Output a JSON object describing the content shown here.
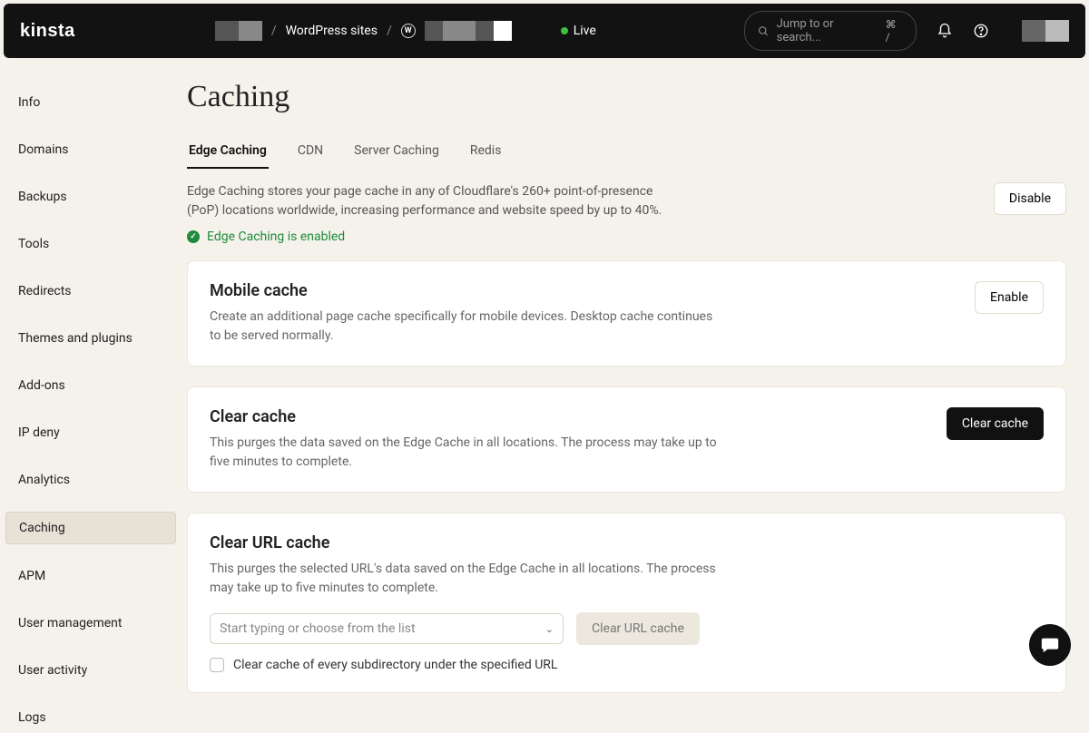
{
  "header": {
    "logo": "kinsta",
    "breadcrumb_sites": "WordPress sites",
    "env_label": "Live",
    "search_placeholder": "Jump to or search...",
    "search_kbd": "⌘ /"
  },
  "sidebar": {
    "items": [
      {
        "label": "Info"
      },
      {
        "label": "Domains"
      },
      {
        "label": "Backups"
      },
      {
        "label": "Tools"
      },
      {
        "label": "Redirects"
      },
      {
        "label": "Themes and plugins"
      },
      {
        "label": "Add-ons"
      },
      {
        "label": "IP deny"
      },
      {
        "label": "Analytics"
      },
      {
        "label": "Caching",
        "active": true
      },
      {
        "label": "APM"
      },
      {
        "label": "User management"
      },
      {
        "label": "User activity"
      },
      {
        "label": "Logs"
      }
    ]
  },
  "page": {
    "title": "Caching",
    "tabs": [
      {
        "label": "Edge Caching",
        "active": true
      },
      {
        "label": "CDN"
      },
      {
        "label": "Server Caching"
      },
      {
        "label": "Redis"
      }
    ],
    "intro": "Edge Caching stores your page cache in any of Cloudflare's 260+ point-of-presence (PoP) locations worldwide, increasing performance and website speed by up to 40%.",
    "status": "Edge Caching is enabled",
    "disable_btn": "Disable"
  },
  "cards": {
    "mobile": {
      "title": "Mobile cache",
      "desc": "Create an additional page cache specifically for mobile devices. Desktop cache continues to be served normally.",
      "btn": "Enable"
    },
    "clear": {
      "title": "Clear cache",
      "desc": "This purges the data saved on the Edge Cache in all locations. The process may take up to five minutes to complete.",
      "btn": "Clear cache"
    },
    "url": {
      "title": "Clear URL cache",
      "desc": "This purges the selected URL's data saved on the Edge Cache in all locations. The process may take up to five minutes to complete.",
      "combo_placeholder": "Start typing or choose from the list",
      "btn": "Clear URL cache",
      "chk_label": "Clear cache of every subdirectory under the specified URL"
    }
  }
}
